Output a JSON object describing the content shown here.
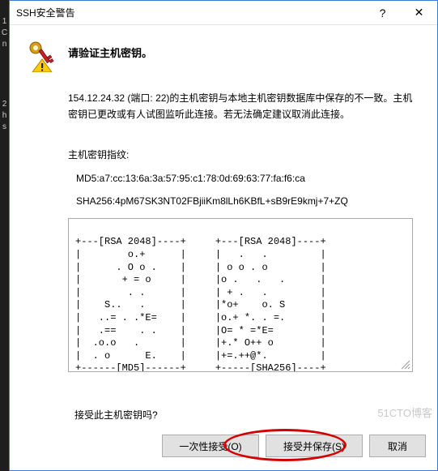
{
  "left_strip": {
    "g1": "1\nC\nn",
    "g2": "2\nh\ns"
  },
  "titlebar": {
    "title": "SSH安全警告",
    "help_glyph": "?",
    "close_glyph": "✕"
  },
  "heading": "请验证主机密钥。",
  "message": "154.12.24.32 (端口: 22)的主机密钥与本地主机密钥数据库中保存的不一致。主机密钥已更改或有人试图监听此连接。若无法确定建议取消此连接。",
  "fingerprint_label": "主机密钥指纹:",
  "fingerprints": {
    "md5": "MD5:a7:cc:13:6a:3a:57:95:c1:78:0d:69:63:77:fa:f6:ca",
    "sha256": "SHA256:4pM67SK3NT02FBjiiKm8lLh6KBfL+sB9rE9kmj+7+ZQ"
  },
  "ascii_art": "+---[RSA 2048]----+     +---[RSA 2048]----+\n|        o.+      |     |   .   .         |\n|      . O o .    |     | o o . o         |\n|       + = o     |     |o .   .   .      |\n|        . .      |     | + .   .         |\n|    S..   .      |     |*o+    o. S      |\n|   ..= . .*E=    |     |o.+ *. . =.      |\n|   .==    . .    |     |O= * =*E=        |\n|  .o.o   .       |     |+.* O++ o        |\n|  . o      E.    |     |+=.++@*.         |\n+------[MD5]------+     +-----[SHA256]----+",
  "accept_question": "接受此主机密钥吗?",
  "buttons": {
    "once": "一次性接受(O)",
    "save": "接受并保存(S)",
    "cancel": "取消"
  },
  "watermark": "51CTO博客"
}
